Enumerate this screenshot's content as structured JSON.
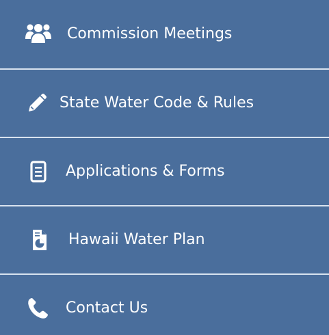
{
  "nav": {
    "items": [
      {
        "label": "Commission Meetings",
        "icon": "group-users-icon"
      },
      {
        "label": "State Water Code & Rules",
        "icon": "pencil-icon"
      },
      {
        "label": "Applications & Forms",
        "icon": "document-icon"
      },
      {
        "label": "Hawaii Water Plan",
        "icon": "report-chart-icon"
      },
      {
        "label": "Contact Us",
        "icon": "phone-icon"
      }
    ]
  },
  "colors": {
    "background": "#4a6e9c",
    "divider": "#d9e3ef",
    "text": "#ffffff"
  }
}
